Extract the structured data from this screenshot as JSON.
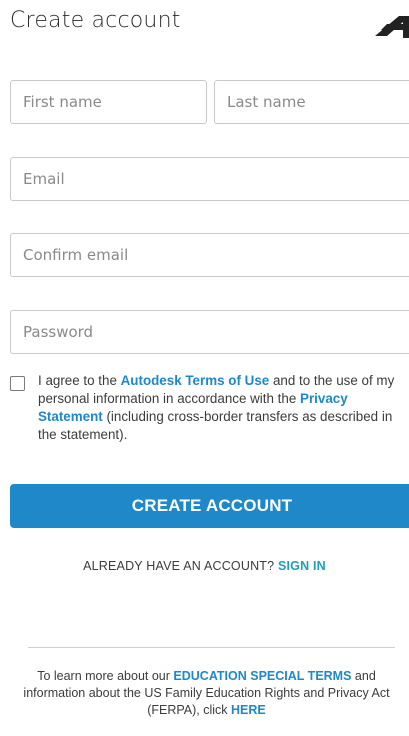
{
  "header": {
    "title": "Create account"
  },
  "form": {
    "first_name": {
      "placeholder": "First name",
      "value": ""
    },
    "last_name": {
      "placeholder": "Last name",
      "value": ""
    },
    "email": {
      "placeholder": "Email",
      "value": ""
    },
    "confirm_email": {
      "placeholder": "Confirm email",
      "value": ""
    },
    "password": {
      "placeholder": "Password",
      "value": ""
    }
  },
  "agreement": {
    "checked": false,
    "text_1": "I agree to the ",
    "terms_link": "Autodesk Terms of Use",
    "text_2": " and to the use of my personal information in accordance with the ",
    "privacy_link": "Privacy Statement",
    "text_3": " (including cross-border transfers as described in the statement)."
  },
  "actions": {
    "create_label": "CREATE ACCOUNT",
    "have_account_text": "ALREADY HAVE AN ACCOUNT? ",
    "sign_in_link": "SIGN IN"
  },
  "footer": {
    "text_1": "To learn more about our ",
    "education_link": "EDUCATION SPECIAL TERMS",
    "text_2": " and information about the US Family Education Rights and Privacy Act (FERPA), click ",
    "here_link": "HERE"
  },
  "colors": {
    "accent": "#1e88c8",
    "signin": "#1e9fb5",
    "logo": "#222222"
  },
  "icons": {
    "logo": "autodesk-logo-icon",
    "checkbox": "checkbox-icon"
  }
}
